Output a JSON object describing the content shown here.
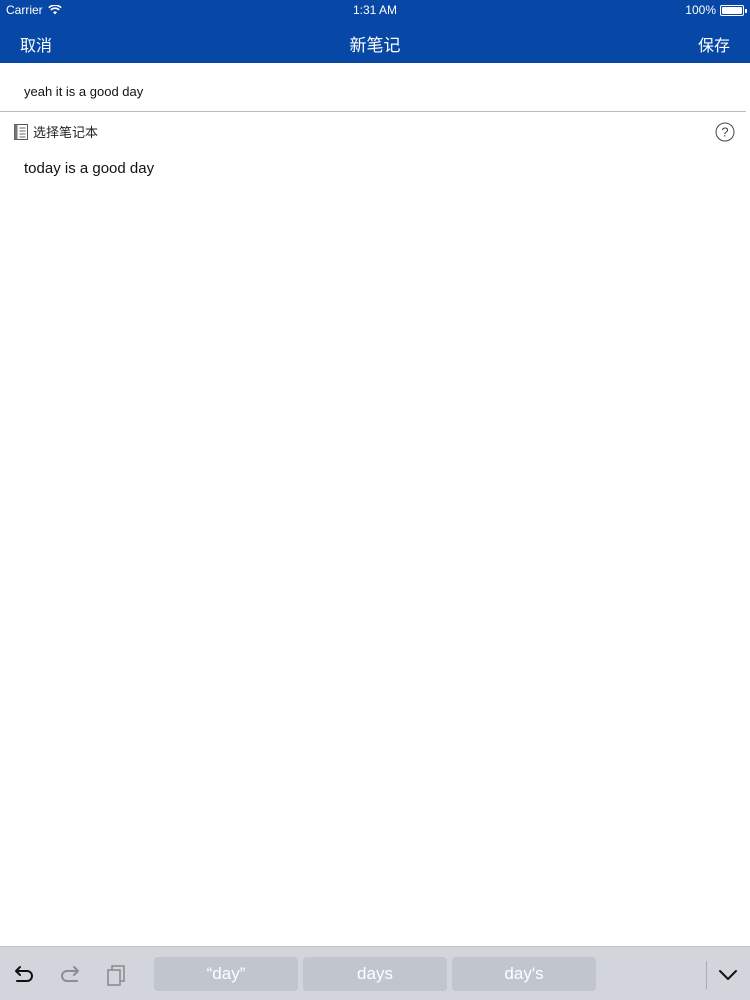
{
  "status_bar": {
    "carrier": "Carrier",
    "time": "1:31 AM",
    "battery": "100%"
  },
  "nav": {
    "cancel_label": "取消",
    "title": "新笔记",
    "save_label": "保存"
  },
  "note": {
    "title_value": "yeah it is a good day",
    "notebook_label": "选择笔记本",
    "body_text": "today is a good day"
  },
  "keyboard_bar": {
    "suggestions": [
      "“day”",
      "days",
      "day's"
    ]
  },
  "colors": {
    "nav_background": "#0747a6",
    "keyboard_bar_background": "#d2d5db",
    "suggestion_background": "#c0c5ce"
  },
  "icons": {
    "wifi": "wifi-icon",
    "battery": "battery-icon",
    "notebook": "notebook-icon",
    "help": "help-icon",
    "undo": "undo-icon",
    "redo": "redo-icon",
    "paste": "paste-icon",
    "dismiss_keyboard": "chevron-down-icon"
  }
}
